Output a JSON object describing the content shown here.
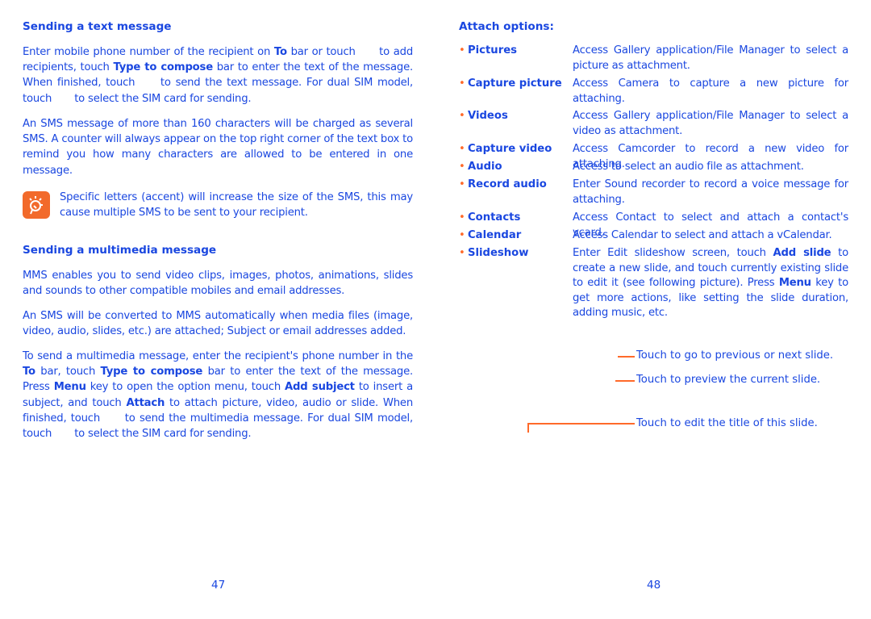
{
  "left": {
    "heading1": "Sending a text message",
    "p1": [
      {
        "t": "Enter mobile phone number of the recipient on "
      },
      {
        "t": "To",
        "b": true
      },
      {
        "t": " bar or touch "
      },
      {
        "gap": true
      },
      {
        "t": " to add recipients, touch "
      },
      {
        "t": "Type to compose",
        "b": true
      },
      {
        "t": " bar to enter the text of the message. When finished, touch "
      },
      {
        "gap": true
      },
      {
        "t": " to send the text message. For dual SIM model, touch "
      },
      {
        "gap": true
      },
      {
        "t": " to select the SIM card for sending."
      }
    ],
    "p2": [
      {
        "t": "An SMS message of more than 160 characters will be charged as several SMS. A counter will always appear on the top right corner of the text box to remind you how many characters are allowed to be entered in one message."
      }
    ],
    "note": [
      {
        "t": "Specific letters (accent) will increase the size of the SMS, this may cause multiple SMS to be sent to your recipient."
      }
    ],
    "heading2": "Sending a multimedia message",
    "p3": [
      {
        "t": "MMS enables you to send video clips, images, photos, animations, slides and sounds to other compatible mobiles and email addresses."
      }
    ],
    "p4": [
      {
        "t": "An SMS will be converted to MMS automatically when media files (image, video, audio, slides, etc.) are attached; Subject or email addresses added."
      }
    ],
    "p5": [
      {
        "t": "To send a multimedia message, enter the recipient's phone number in the "
      },
      {
        "t": "To",
        "b": true
      },
      {
        "t": " bar, touch "
      },
      {
        "t": "Type to compose",
        "b": true
      },
      {
        "t": " bar to enter the text of the message. Press "
      },
      {
        "t": "Menu",
        "b": true
      },
      {
        "t": " key to open the option menu, touch "
      },
      {
        "t": "Add subject",
        "b": true
      },
      {
        "t": " to insert a subject, and touch "
      },
      {
        "t": "Attach",
        "b": true
      },
      {
        "t": " to attach picture, video, audio or slide. When finished, touch "
      },
      {
        "gap": true
      },
      {
        "t": " to send the multimedia message. For dual SIM model, touch "
      },
      {
        "gap": true
      },
      {
        "t": " to select the SIM card for sending."
      }
    ],
    "page_number": "47"
  },
  "right": {
    "heading": "Attach options:",
    "items": [
      {
        "term": "Pictures",
        "desc": [
          {
            "t": "Access Gallery application/File Manager to select a picture as attachment."
          }
        ]
      },
      {
        "term": "Capture picture",
        "desc": [
          {
            "t": "Access Camera to capture a new picture for attaching."
          }
        ]
      },
      {
        "term": "Videos",
        "desc": [
          {
            "t": "Access Gallery application/File Manager to select a video as attachment."
          }
        ]
      },
      {
        "term": "Capture video",
        "desc": [
          {
            "t": "Access Camcorder to record a new video for attaching."
          }
        ]
      },
      {
        "term": "Audio",
        "desc": [
          {
            "t": "Access to select an audio file as attachment."
          }
        ]
      },
      {
        "term": "Record audio",
        "desc": [
          {
            "t": "Enter Sound recorder to record a voice message for attaching."
          }
        ]
      },
      {
        "term": "Contacts",
        "desc": [
          {
            "t": "Access Contact to select and attach a contact's vcard."
          }
        ]
      },
      {
        "term": "Calendar",
        "desc": [
          {
            "t": "Access Calendar to select and attach a vCalendar."
          }
        ]
      },
      {
        "term": "Slideshow",
        "desc": [
          {
            "t": "Enter Edit slideshow screen, touch "
          },
          {
            "t": "Add slide",
            "b": true
          },
          {
            "t": " to create a new slide, and touch currently existing slide to edit it (see following picture). Press "
          },
          {
            "t": "Menu",
            "b": true
          },
          {
            "t": " key to get more actions, like setting the slide duration, adding music, etc."
          }
        ]
      }
    ],
    "callouts": [
      "Touch to go to previous or next slide.",
      "Touch to preview the current slide.",
      "Touch to edit the title of this slide."
    ],
    "page_number": "48"
  },
  "colors": {
    "text": "#1a47e0",
    "accent": "#ff6a2a"
  },
  "icons": {
    "note": "lightbulb-icon"
  }
}
